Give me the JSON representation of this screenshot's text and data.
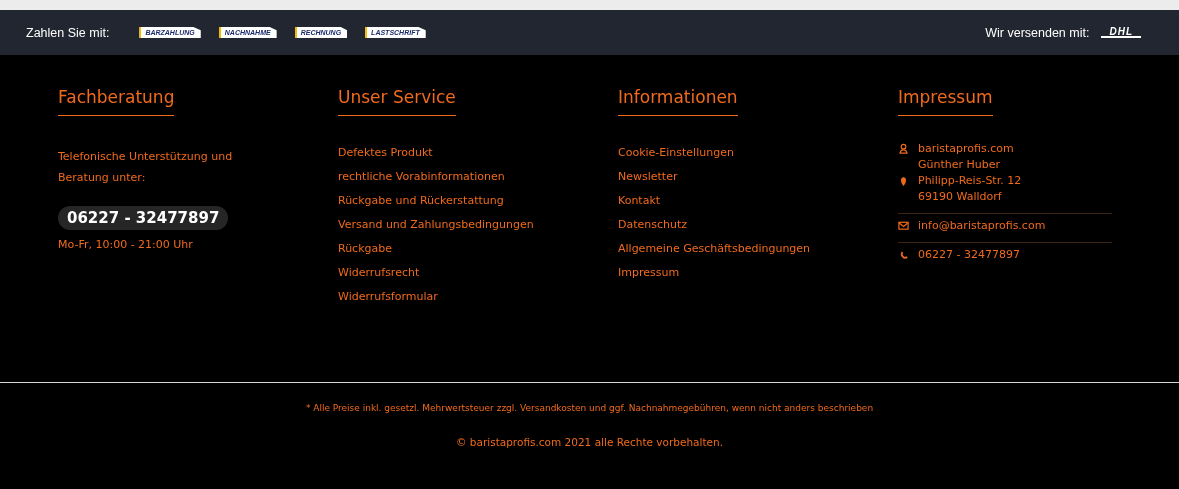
{
  "payment_bar": {
    "label": "Zahlen Sie mit:",
    "methods": [
      "BARZAHLUNG",
      "NACHNAHME",
      "RECHNUNG",
      "LASTSCHRIFT"
    ],
    "shipping_label": "Wir versenden mit:",
    "carrier": "DHL"
  },
  "columns": [
    {
      "kind": "contact",
      "heading": "Fachberatung",
      "text": "Telefonische Unterstützung und Beratung unter:",
      "phone": "06227 - 32477897",
      "hours": "Mo-Fr, 10:00 - 21:00 Uhr"
    },
    {
      "kind": "links",
      "heading": "Unser Service",
      "links": [
        "Defektes Produkt",
        "rechtliche Vorabinformationen",
        "Rückgabe und Rückerstattung",
        "Versand und Zahlungsbedingungen",
        "Rückgabe",
        "Widerrufsrecht",
        "Widerrufsformular"
      ]
    },
    {
      "kind": "links",
      "heading": "Informationen",
      "links": [
        "Cookie-Einstellungen",
        "Newsletter",
        "Kontakt",
        "Datenschutz",
        "Allgemeine Geschäftsbedingungen",
        "Impressum"
      ]
    },
    {
      "kind": "address",
      "heading": "Impressum",
      "groups": [
        [
          {
            "kind": "person",
            "text": "baristaprofis.com"
          },
          {
            "kind": "plain",
            "text": "Günther Huber"
          },
          {
            "kind": "pin",
            "text": "Philipp-Reis-Str. 12"
          },
          {
            "kind": "plain",
            "text": "69190 Walldorf"
          }
        ],
        [
          {
            "kind": "mail",
            "text": "info@baristaprofis.com"
          }
        ],
        [
          {
            "kind": "phone",
            "text": "06227 - 32477897"
          }
        ]
      ]
    }
  ],
  "notice": "* Alle Preise inkl. gesetzl. Mehrwertsteuer zzgl. Versandkosten und ggf. Nachnahmegebühren, wenn nicht anders beschrieben",
  "copyright": "© baristaprofis.com 2021 alle Rechte vorbehalten."
}
